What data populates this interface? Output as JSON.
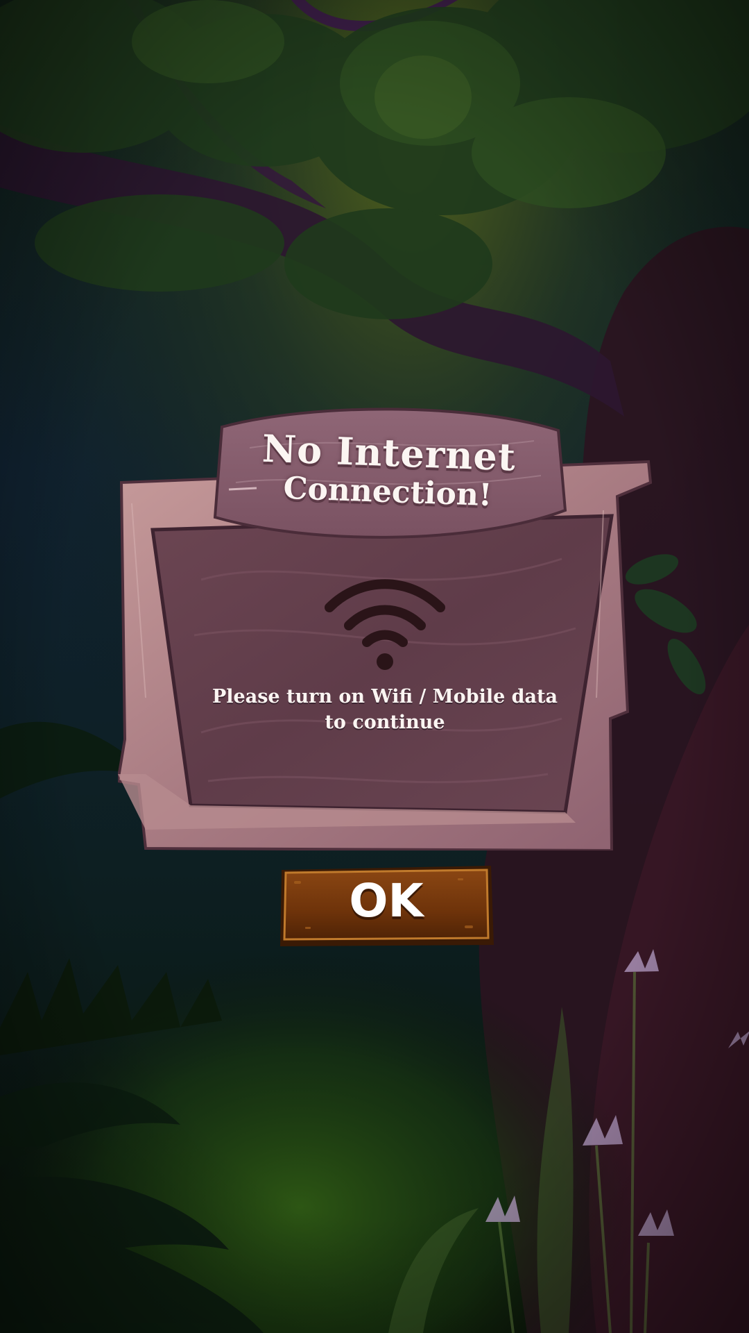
{
  "screen": "no-internet-dialog",
  "dialog": {
    "title_line1": "No Internet",
    "title_line2": "Connection!",
    "icon": "wifi-icon",
    "message_line1": "Please turn on Wifi / Mobile data",
    "message_line2": "to continue"
  },
  "ok_button": {
    "label": "OK"
  },
  "colors": {
    "plank_light": "#b88c8f",
    "plank_dark": "#6b4453",
    "panel_inner": "#5e3b48",
    "button_wood": "#7a3a0c",
    "button_wood_dark": "#4a2206",
    "text": "#fbf5f2",
    "icon": "#2a1418"
  }
}
